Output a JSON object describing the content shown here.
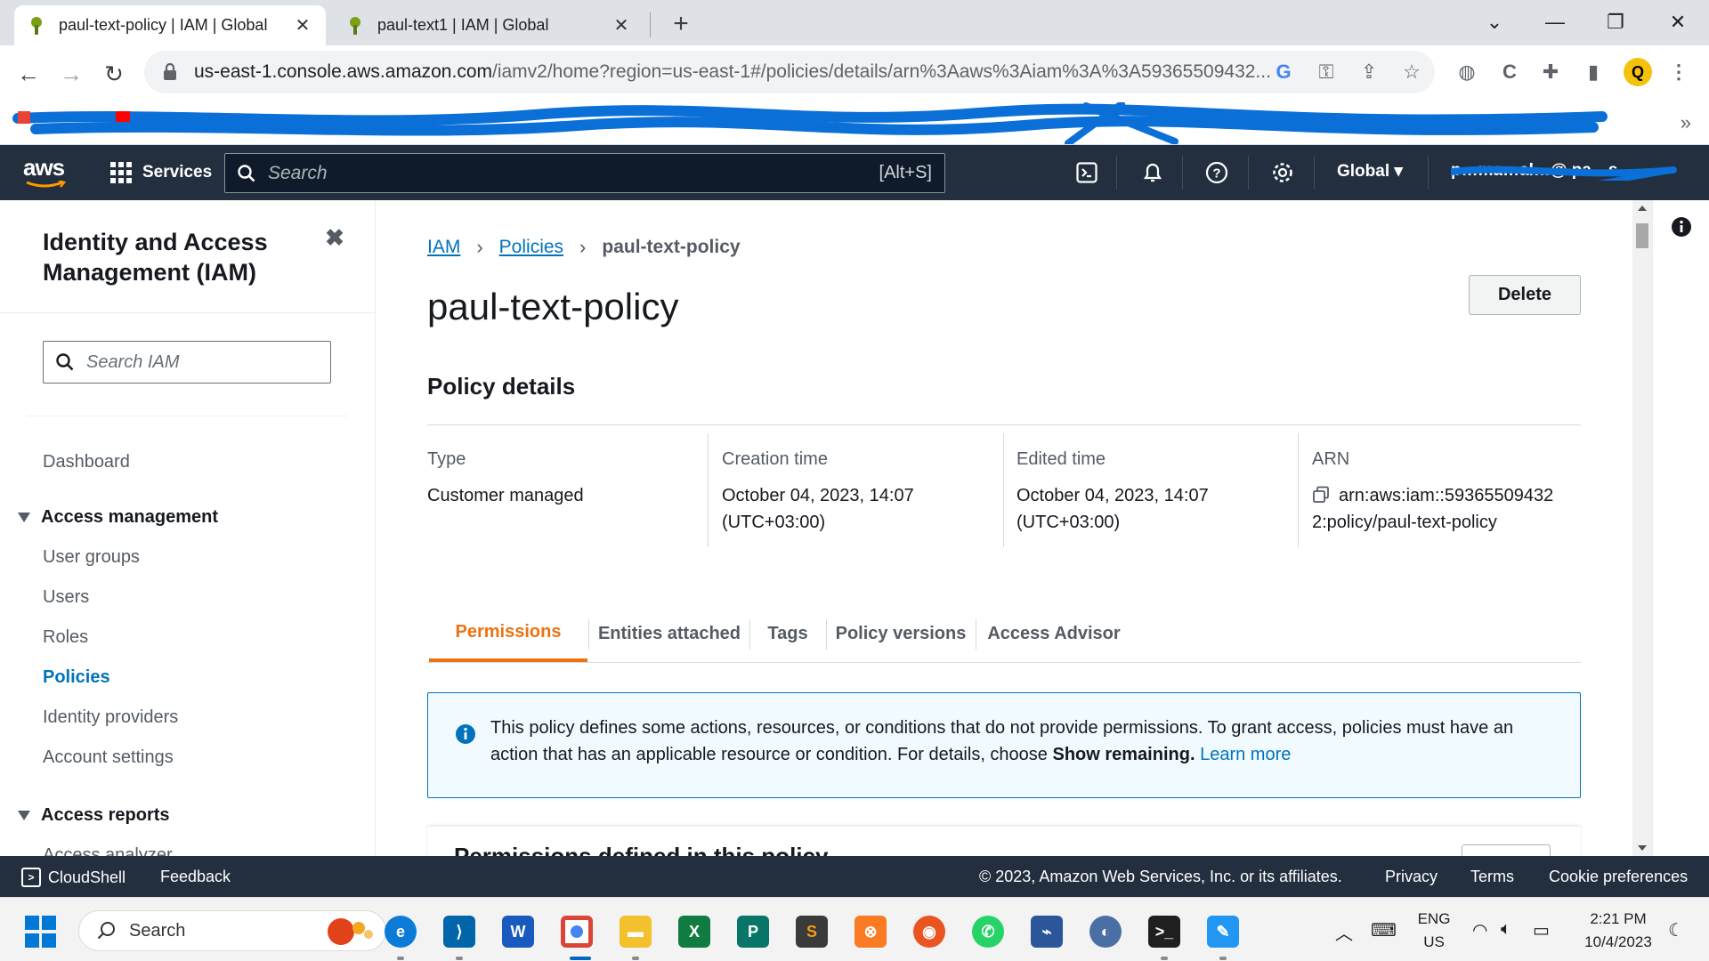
{
  "browser": {
    "tabs": [
      {
        "title": "paul-text-policy | IAM | Global",
        "active": true
      },
      {
        "title": "paul-text1 | IAM | Global",
        "active": false
      }
    ],
    "new_tab_label": "+",
    "url_host": "us-east-1.console.aws.amazon.com",
    "url_path": "/iamv2/home?region=us-east-1#/policies/details/arn%3Aaws%3Aiam%3A%3A59365509432...",
    "bookmarks_more": "»",
    "toolbar_icons": [
      "google-icon",
      "key-icon",
      "share-icon",
      "star-icon",
      "globe-icon",
      "extension-c-icon",
      "puzzle-icon",
      "sidepanel-icon",
      "profile-icon",
      "menu-icon"
    ]
  },
  "aws_nav": {
    "logo_text": "aws",
    "services_label": "Services",
    "search_placeholder": "Search",
    "search_shortcut": "[Alt+S]",
    "region_label": "Global ▾",
    "account_label": "p…ma…al…@ pa…s…"
  },
  "sidebar": {
    "title": "Identity and Access Management (IAM)",
    "close_label": "✖",
    "search_placeholder": "Search IAM",
    "dashboard_label": "Dashboard",
    "access_management_label": "Access management",
    "items": [
      {
        "label": "User groups",
        "active": false
      },
      {
        "label": "Users",
        "active": false
      },
      {
        "label": "Roles",
        "active": false
      },
      {
        "label": "Policies",
        "active": true
      },
      {
        "label": "Identity providers",
        "active": false
      },
      {
        "label": "Account settings",
        "active": false
      }
    ],
    "access_reports_label": "Access reports",
    "access_analyzer_label": "Access analyzer"
  },
  "main": {
    "breadcrumb": [
      "IAM",
      "Policies",
      "paul-text-policy"
    ],
    "page_title": "paul-text-policy",
    "delete_label": "Delete",
    "details_heading": "Policy details",
    "details": {
      "type_label": "Type",
      "type_value": "Customer managed",
      "creation_label": "Creation time",
      "creation_value_1": "October 04, 2023, 14:07",
      "creation_value_2": "(UTC+03:00)",
      "edited_label": "Edited time",
      "edited_value_1": "October 04, 2023, 14:07",
      "edited_value_2": "(UTC+03:00)",
      "arn_label": "ARN",
      "arn_value_1": "arn:aws:iam::59365509432",
      "arn_value_2": "2:policy/paul-text-policy"
    },
    "tabs": [
      "Permissions",
      "Entities attached",
      "Tags",
      "Policy versions",
      "Access Advisor"
    ],
    "active_tab": "Permissions",
    "alert": {
      "text_1": "This policy defines some actions, resources, or conditions that do not provide permissions. To grant access, policies must have an action that has an applicable resource or condition. For details, choose ",
      "bold": "Show remaining.",
      "link": "Learn more"
    },
    "permissions_heading": "Permissions defined in this policy"
  },
  "aws_footer": {
    "cloudshell": "CloudShell",
    "feedback": "Feedback",
    "copyright": "© 2023, Amazon Web Services, Inc. or its affiliates.",
    "privacy": "Privacy",
    "terms": "Terms",
    "cookie": "Cookie preferences"
  },
  "taskbar": {
    "search_placeholder": "Search",
    "language_1": "ENG",
    "language_2": "US",
    "time": "2:21 PM",
    "date": "10/4/2023"
  },
  "colors": {
    "aws_nav_bg": "#232f3e",
    "link": "#0073bb",
    "active_tab": "#ec7211",
    "scribble": "#0a6fd6"
  }
}
